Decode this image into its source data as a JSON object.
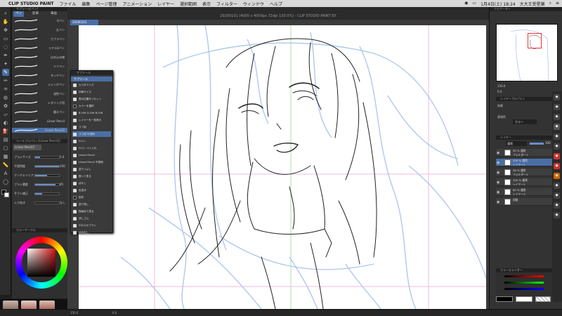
{
  "menubar": {
    "apple": "",
    "app_name": "CLIP STUDIO PAINT",
    "items": [
      "ファイル",
      "編集",
      "ページ管理",
      "アニメーション",
      "レイヤー",
      "選択範囲",
      "表示",
      "フィルター",
      "ウィンドウ",
      "ヘルプ"
    ],
    "date_time": "1月4日(土) 18:24",
    "user": "大大王受星樂"
  },
  "window_title": "20200101 (4000 x 4000px 72dpi 150.0%) - CLIP STUDIO PAINT EX",
  "doc_tab": "20200101",
  "left_panel": {
    "header": "サブツール[ペン]",
    "tabs": [
      "ペン",
      "鉛筆",
      "筆画"
    ],
    "brushes": [
      "Gペン",
      "丸ペン",
      "カブラペン",
      "リアルGペン",
      "はめ込み線",
      "ミリペン",
      "タッチペン",
      "ジャンボペン",
      "油性ペン",
      "レタリング用",
      "墨汁ペン",
      "Linear Pencil",
      "Linear Pencil2"
    ],
    "selected_brush_index": 12,
    "props_header": "ツールプロパティ[Linear Pencil2]",
    "tool_name": "Linear Pencil2",
    "props": [
      {
        "label": "ブラシサイズ",
        "value": "5.0",
        "level": 0.2
      },
      {
        "label": "不透明度",
        "value": "100",
        "level": 1.0
      },
      {
        "label": "アンチエイリアス",
        "value": "",
        "level": 0.5
      },
      {
        "label": "ブラシ濃度",
        "value": "85",
        "level": 0.85
      },
      {
        "label": "手ブレ補正",
        "value": "",
        "level": 0.3
      },
      {
        "label": "入り抜き",
        "value": "なし",
        "level": 0
      }
    ]
  },
  "color_panel": {
    "header": "カラーサークル",
    "main_color": "#d21414"
  },
  "subtool_popup": {
    "header": "サブツール",
    "title": "サブツール",
    "items": [
      {
        "label": "カスタマイズ",
        "dark": false
      },
      {
        "label": "印刷サイズ",
        "dark": false
      },
      {
        "label": "表示位置をリセット",
        "dark": false
      },
      {
        "label": "カラーを選択",
        "dark": true
      },
      {
        "label": "R:256 G:256 B:256",
        "dark": false
      },
      {
        "label": "レイヤーを一覧表示",
        "dark": false
      },
      {
        "label": "ラフ用",
        "dark": false
      },
      {
        "label": "ラフ用 半透明",
        "dark": false,
        "selected": true
      },
      {
        "label": "Gペン",
        "dark": false
      },
      {
        "label": "Gペン ペン入れ",
        "dark": false
      },
      {
        "label": "Linear Pencil",
        "dark": false
      },
      {
        "label": "Linear Pencil 不透明",
        "dark": false
      },
      {
        "label": "塗りつぶし",
        "dark": false
      },
      {
        "label": "囲って塗る",
        "dark": false
      },
      {
        "label": "ぼかし",
        "dark": false
      },
      {
        "label": "色混ぜ",
        "dark": false
      },
      {
        "label": "指先",
        "dark": true
      },
      {
        "label": "塗り残し",
        "dark": false
      },
      {
        "label": "描画色で塗る",
        "dark": false
      },
      {
        "label": "消しゴム",
        "dark": false
      },
      {
        "label": "やわらかブラシ",
        "dark": false
      },
      {
        "label": "はみ出し",
        "dark": false
      }
    ]
  },
  "right_panel": {
    "navigator_header": "ナビゲーター",
    "zoom": "150.0",
    "rotation": "0.0",
    "layer_property_header": "レイヤープロパティ",
    "effect_label": "効果",
    "expression_label": "表現色",
    "expression_value": "カラー",
    "layers_header": "レイヤー",
    "blend_mode": "通常",
    "opacity": "100",
    "layers": [
      {
        "name": "50 % 通常",
        "sub": "フォルダー1",
        "selected": false
      },
      {
        "name": "100 % 通常",
        "sub": "レイヤー1",
        "selected": true
      },
      {
        "name": "28 % 通常",
        "sub": "フォルダー2",
        "selected": false
      },
      {
        "name": "100 % 通常",
        "sub": "レイヤー2",
        "selected": false
      },
      {
        "name": "60 % 通常",
        "sub": "レイヤー3",
        "selected": false
      },
      {
        "name": "",
        "sub": "用紙",
        "selected": false
      }
    ],
    "color_slider_header": "カラースライダー"
  },
  "status": {
    "zoom": "150.0",
    "angle": "0.0"
  }
}
